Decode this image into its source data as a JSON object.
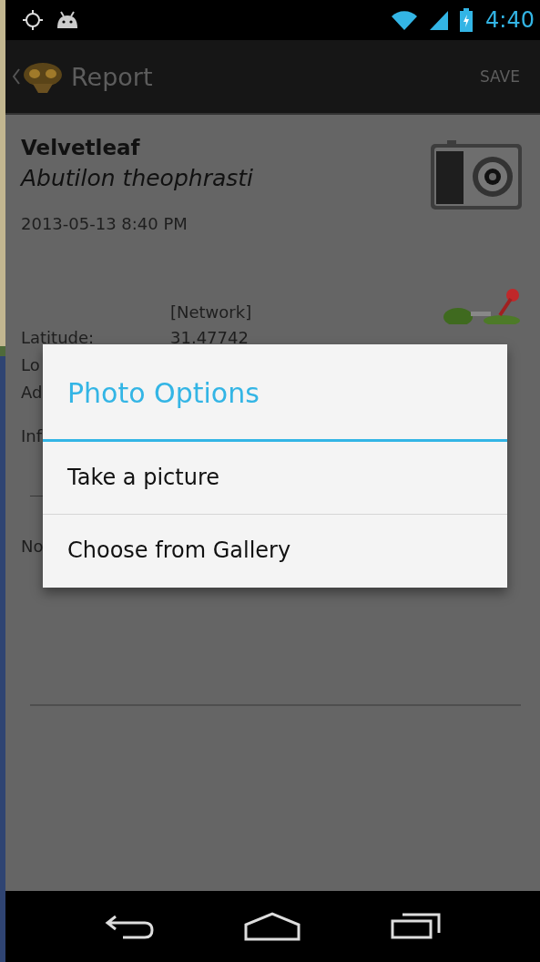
{
  "status_bar": {
    "time": "4:40"
  },
  "action_bar": {
    "title": "Report",
    "action": "SAVE"
  },
  "report": {
    "common_name": "Velvetleaf",
    "scientific_name": "Abutilon theophrasti",
    "datetime": "2013-05-13 8:40 PM",
    "location_source": "[Network]",
    "fields": [
      {
        "label": "Latitude:",
        "value": "31.47742"
      },
      {
        "label": "Lo"
      },
      {
        "label": "Ad"
      }
    ],
    "info_label": "Inf",
    "notes_label": "No"
  },
  "dialog": {
    "title": "Photo Options",
    "options": [
      "Take a picture",
      "Choose from Gallery"
    ]
  }
}
